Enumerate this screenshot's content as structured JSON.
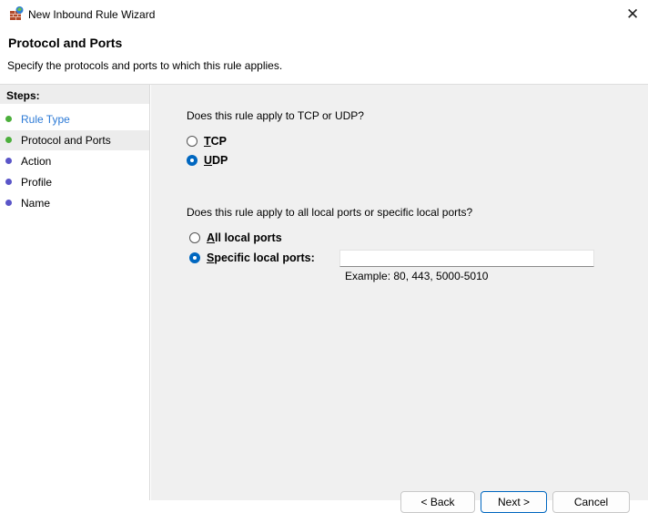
{
  "window": {
    "title": "New Inbound Rule Wizard",
    "close_glyph": "✕",
    "icon": "firewall-rule-icon"
  },
  "header": {
    "title": "Protocol and Ports",
    "subtitle": "Specify the protocols and ports to which this rule applies."
  },
  "steps": {
    "title": "Steps:",
    "items": [
      {
        "label": "Rule Type",
        "state": "completed",
        "color": "#2c7ad6",
        "dot": "#4caf3c"
      },
      {
        "label": "Protocol and Ports",
        "state": "current",
        "color": "#000000",
        "dot": "#4caf3c"
      },
      {
        "label": "Action",
        "state": "pending",
        "color": "#000000",
        "dot": "#5a55c8"
      },
      {
        "label": "Profile",
        "state": "pending",
        "color": "#000000",
        "dot": "#5a55c8"
      },
      {
        "label": "Name",
        "state": "pending",
        "color": "#000000",
        "dot": "#5a55c8"
      }
    ]
  },
  "protocol": {
    "question": "Does this rule apply to TCP or UDP?",
    "options": [
      {
        "mnemonic": "T",
        "rest": "CP",
        "checked": false
      },
      {
        "mnemonic": "U",
        "rest": "DP",
        "checked": true
      }
    ]
  },
  "ports": {
    "question": "Does this rule apply to all local ports or specific local ports?",
    "options": [
      {
        "mnemonic": "A",
        "rest": "ll local ports",
        "checked": false
      },
      {
        "mnemonic": "S",
        "rest": "pecific local ports:",
        "checked": true
      }
    ],
    "value": "",
    "example": "Example: 80, 443, 5000-5010"
  },
  "buttons": {
    "back": "< Back",
    "next": "Next >",
    "cancel": "Cancel"
  },
  "colors": {
    "accent": "#0067c0",
    "panel": "#f0f0f0"
  }
}
